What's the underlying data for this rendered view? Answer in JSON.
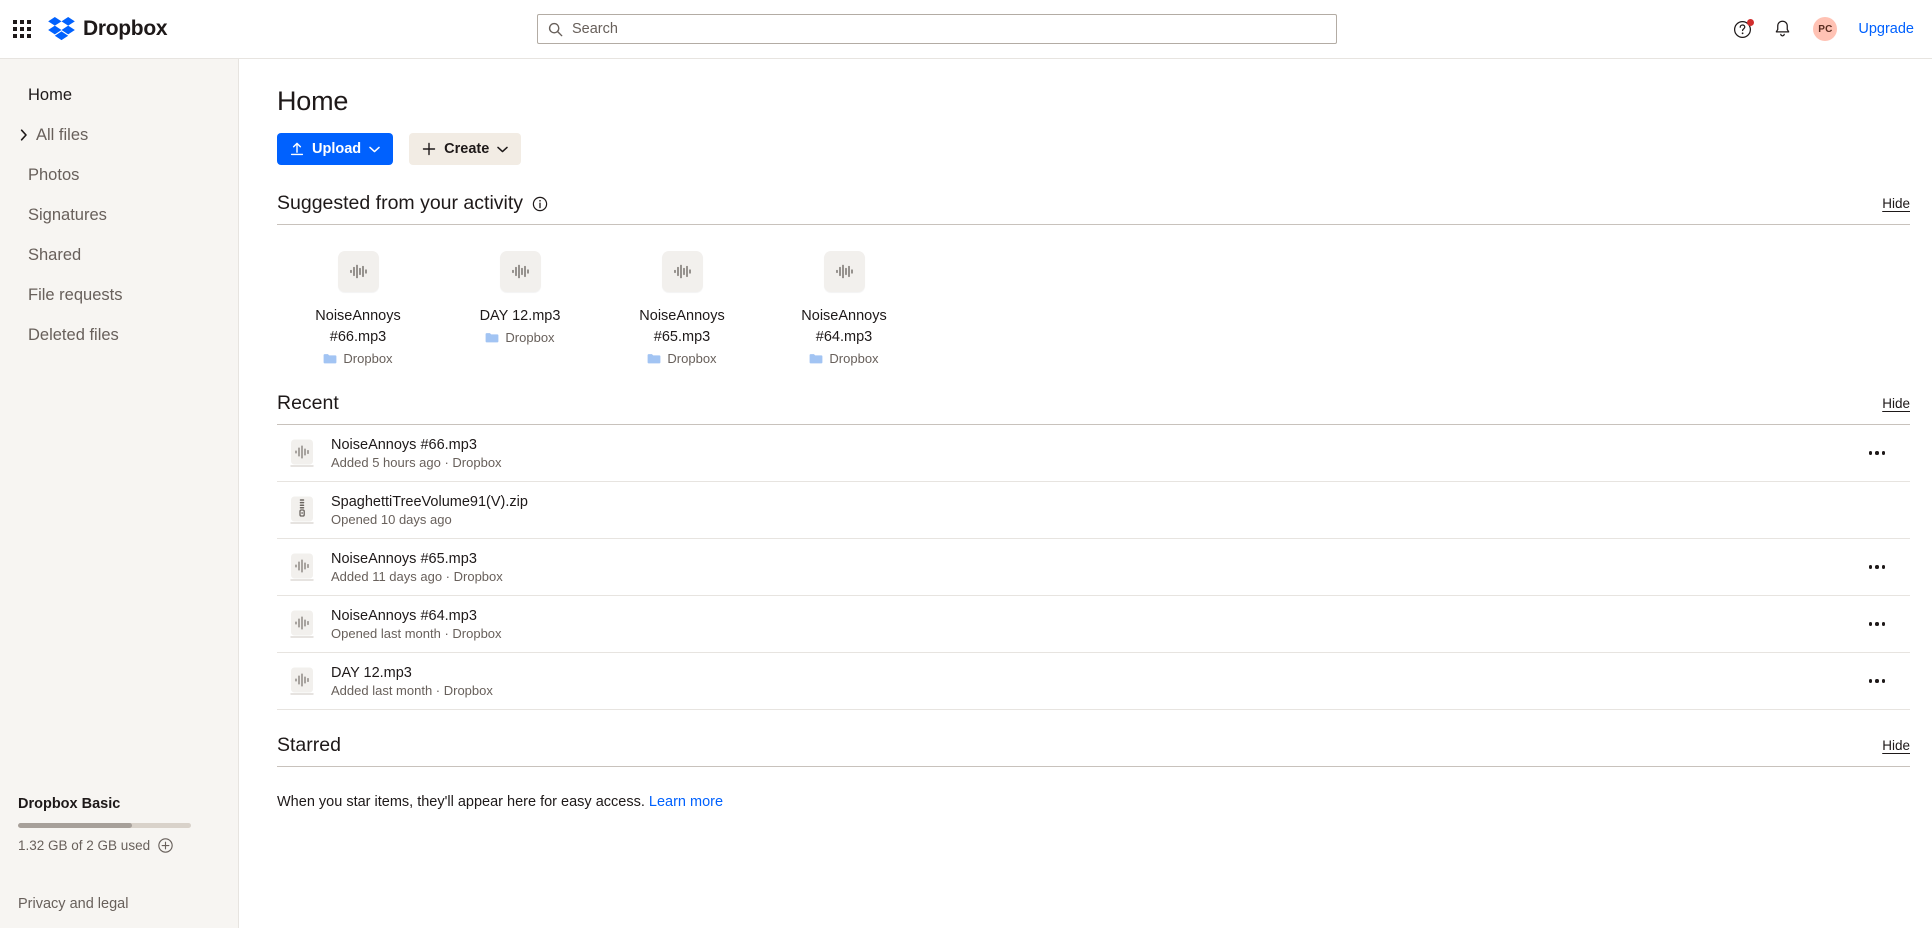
{
  "topbar": {
    "apps_icon": "grid-apps-icon",
    "brand": "Dropbox",
    "search": {
      "placeholder": "Search",
      "value": "",
      "icon": "search-icon"
    },
    "help_icon": "help-circle-icon",
    "help_badge": true,
    "notifications_icon": "bell-icon",
    "avatar_initials": "PC",
    "upgrade_label": "Upgrade"
  },
  "sidebar": {
    "items": [
      {
        "label": "Home",
        "active": true,
        "caret": false
      },
      {
        "label": "All files",
        "active": false,
        "caret": true
      },
      {
        "label": "Photos",
        "active": false,
        "caret": false
      },
      {
        "label": "Signatures",
        "active": false,
        "caret": false
      },
      {
        "label": "Shared",
        "active": false,
        "caret": false
      },
      {
        "label": "File requests",
        "active": false,
        "caret": false
      },
      {
        "label": "Deleted files",
        "active": false,
        "caret": false
      }
    ],
    "plan": {
      "name": "Dropbox Basic",
      "usage": "1.32 GB of 2 GB used",
      "percent": 66,
      "add_icon": "plus-circle-icon"
    },
    "privacy_label": "Privacy and legal"
  },
  "main": {
    "title": "Home",
    "upload_button": {
      "label": "Upload",
      "icon": "upload-icon",
      "caret": "chevron-down-icon"
    },
    "create_button": {
      "label": "Create",
      "icon": "plus-icon",
      "caret": "chevron-down-icon"
    },
    "suggested": {
      "title": "Suggested from your activity",
      "info_icon": "info-circle-icon",
      "hide_label": "Hide",
      "cards": [
        {
          "name": "NoiseAnnoys #66.mp3",
          "location": "Dropbox",
          "icon": "audio-waveform-icon"
        },
        {
          "name": "DAY 12.mp3",
          "location": "Dropbox",
          "icon": "audio-waveform-icon"
        },
        {
          "name": "NoiseAnnoys #65.mp3",
          "location": "Dropbox",
          "icon": "audio-waveform-icon"
        },
        {
          "name": "NoiseAnnoys #64.mp3",
          "location": "Dropbox",
          "icon": "audio-waveform-icon"
        }
      ]
    },
    "recent": {
      "title": "Recent",
      "hide_label": "Hide",
      "rows": [
        {
          "name": "NoiseAnnoys #66.mp3",
          "sub": "Added 5 hours ago · Dropbox",
          "icon": "audio-waveform-icon",
          "menu": true
        },
        {
          "name": "SpaghettiTreeVolume91(V).zip",
          "sub": "Opened 10 days ago",
          "icon": "zip-archive-icon",
          "menu": false
        },
        {
          "name": "NoiseAnnoys #65.mp3",
          "sub": "Added 11 days ago · Dropbox",
          "icon": "audio-waveform-icon",
          "menu": true
        },
        {
          "name": "NoiseAnnoys #64.mp3",
          "sub": "Opened last month · Dropbox",
          "icon": "audio-waveform-icon",
          "menu": true
        },
        {
          "name": "DAY 12.mp3",
          "sub": "Added last month · Dropbox",
          "icon": "audio-waveform-icon",
          "menu": true
        }
      ]
    },
    "starred": {
      "title": "Starred",
      "hide_label": "Hide",
      "empty_text": "When you star items, they'll appear here for easy access.",
      "learn_more_label": "Learn more"
    }
  },
  "colors": {
    "brand_blue": "#0061fe",
    "sidebar_bg": "#f7f5f2",
    "create_bg": "#f2ece4",
    "avatar_bg": "#ffc2b4",
    "badge_red": "#d12e2e",
    "folder_blue": "#a2c4f3"
  }
}
